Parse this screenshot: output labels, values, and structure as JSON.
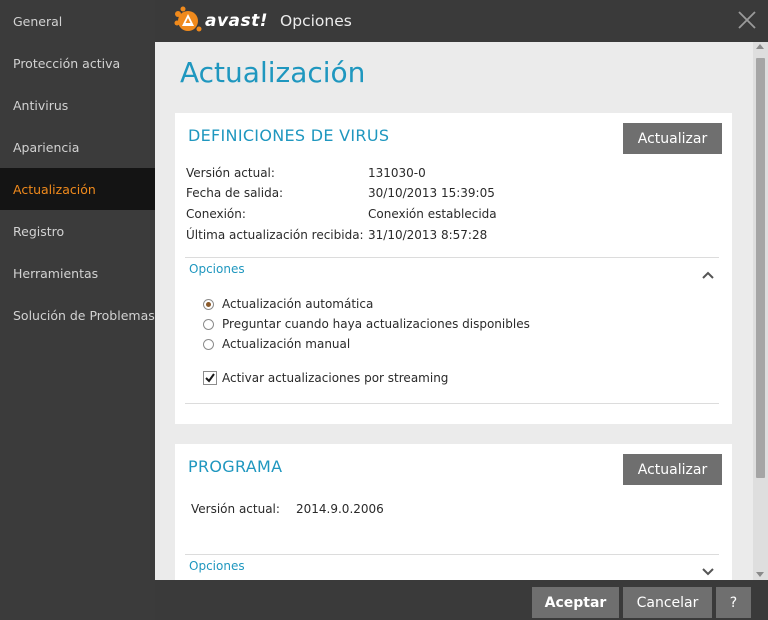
{
  "window": {
    "brand": "avast!",
    "title": "Opciones"
  },
  "sidebar": {
    "items": [
      {
        "label": "General"
      },
      {
        "label": "Protección activa"
      },
      {
        "label": "Antivirus"
      },
      {
        "label": "Apariencia"
      },
      {
        "label": "Actualización",
        "active": true
      },
      {
        "label": "Registro"
      },
      {
        "label": "Herramientas"
      },
      {
        "label": "Solución de Problemas"
      }
    ]
  },
  "page": {
    "title": "Actualización"
  },
  "virus_definitions": {
    "heading": "DEFINICIONES DE VIRUS",
    "update_button": "Actualizar",
    "rows": [
      {
        "label": "Versión actual:",
        "value": "131030-0"
      },
      {
        "label": "Fecha de salida:",
        "value": "30/10/2013 15:39:05"
      },
      {
        "label": "Conexión:",
        "value": "Conexión establecida"
      },
      {
        "label": "Última actualización recibida:",
        "value": "31/10/2013 8:57:28"
      }
    ],
    "options_label": "Opciones",
    "options_expanded": true,
    "radio_options": [
      {
        "label": "Actualización automática",
        "selected": true
      },
      {
        "label": "Preguntar cuando haya actualizaciones disponibles",
        "selected": false
      },
      {
        "label": "Actualización manual",
        "selected": false
      }
    ],
    "streaming_checkbox": {
      "label": "Activar actualizaciones por streaming",
      "checked": true
    }
  },
  "program": {
    "heading": "PROGRAMA",
    "update_button": "Actualizar",
    "version_label": "Versión actual:",
    "version_value": "2014.9.0.2006",
    "options_label": "Opciones",
    "options_expanded": false
  },
  "footer": {
    "accept": "Aceptar",
    "cancel": "Cancelar",
    "help": "?"
  },
  "colors": {
    "accent_blue": "#1f97bf",
    "active_orange": "#f08a1c",
    "button_gray": "#6f6f6f"
  }
}
